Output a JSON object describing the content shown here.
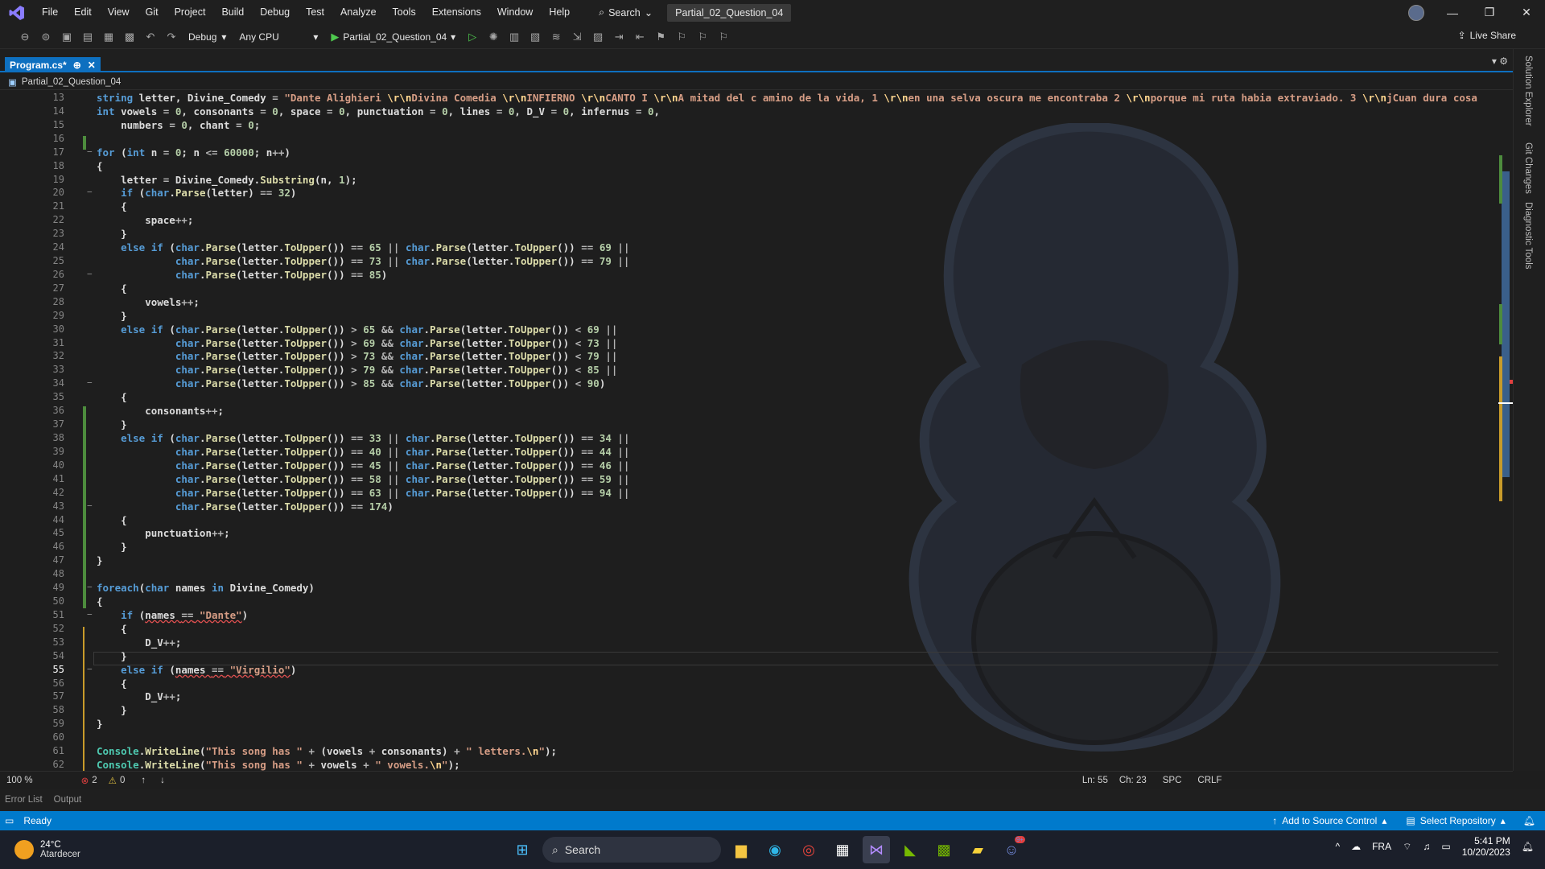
{
  "menubar": {
    "items": [
      "File",
      "Edit",
      "View",
      "Git",
      "Project",
      "Build",
      "Debug",
      "Test",
      "Analyze",
      "Tools",
      "Extensions",
      "Window",
      "Help"
    ],
    "search_label": "Search",
    "solution_name": "Partial_02_Question_04"
  },
  "toolbar": {
    "config": "Debug",
    "platform": "Any CPU",
    "run_target": "Partial_02_Question_04",
    "live_share": "Live Share"
  },
  "tab": {
    "label": "Program.cs*",
    "pin": "⊕",
    "close": "✕"
  },
  "nav": {
    "project": "Partial_02_Question_04"
  },
  "right_rail": {
    "tabs": [
      "Solution Explorer",
      "Git Changes",
      "Diagnostic Tools"
    ]
  },
  "code": {
    "line_numbers": [
      "13",
      "14",
      "15",
      "16",
      "17",
      "18",
      "19",
      "20",
      "21",
      "22",
      "23",
      "24",
      "25",
      "26",
      "27",
      "28",
      "29",
      "30",
      "31",
      "32",
      "33",
      "34",
      "35",
      "36",
      "37",
      "38",
      "39",
      "40",
      "41",
      "42",
      "43",
      "44",
      "45",
      "46",
      "47",
      "48",
      "49",
      "50",
      "51",
      "52",
      "53",
      "54",
      "55",
      "56",
      "57",
      "58",
      "59",
      "60",
      "61",
      "62"
    ],
    "current_line": "55"
  },
  "editor_status": {
    "zoom": "100 %",
    "errors": "2",
    "warnings": "0",
    "line": "Ln: 55",
    "col": "Ch: 23",
    "spacing": "SPC",
    "eol": "CRLF"
  },
  "bottom_tabs": [
    "Error List",
    "Output"
  ],
  "statusbar": {
    "state": "Ready",
    "source_control": "Add to Source Control",
    "repo": "Select Repository"
  },
  "taskbar": {
    "weather_temp": "24°C",
    "weather_desc": "Atardecer",
    "search": "Search",
    "lang": "FRA",
    "time": "5:41 PM",
    "date": "10/20/2023",
    "discord_badge": "9+"
  }
}
